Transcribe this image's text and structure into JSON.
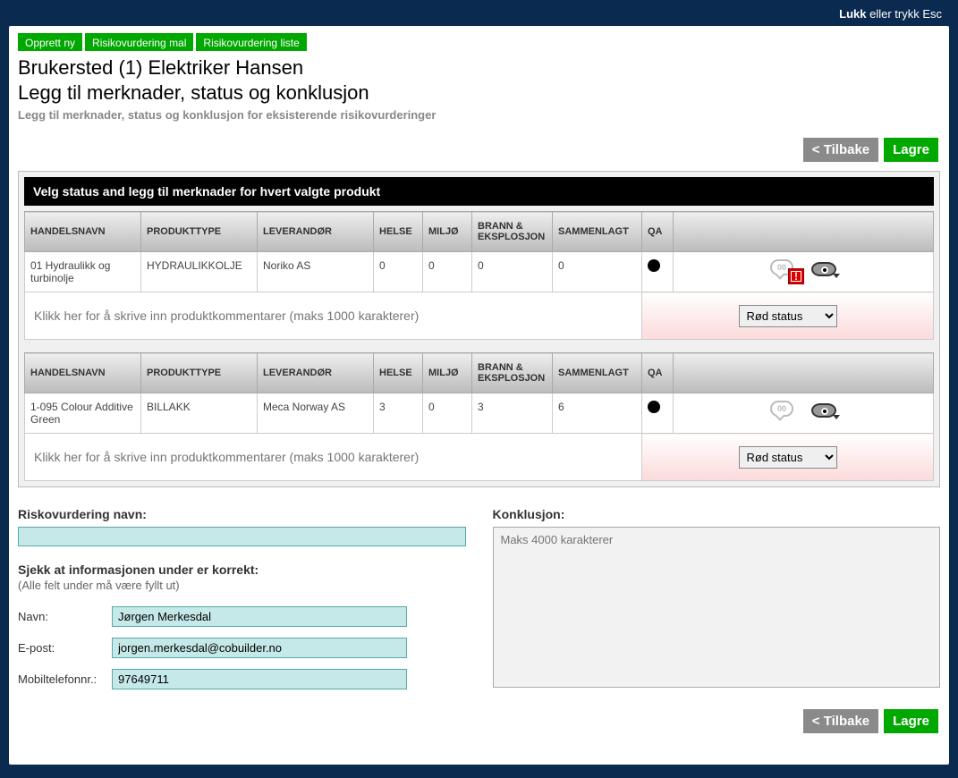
{
  "modal": {
    "close_text": "Lukk",
    "close_hint": " eller trykk Esc"
  },
  "tabs": {
    "a": "Opprett ny",
    "b": "Risikovurdering mal",
    "c": "Risikovurdering liste"
  },
  "title": "Brukersted (1) Elektriker Hansen",
  "subtitle": "Legg til merknader, status og konklusjon",
  "desc": "Legg til merknader, status og konklusjon for eksisterende risikovurderinger",
  "btn": {
    "back": "< Tilbake",
    "save": "Lagre"
  },
  "table_head": "Velg status and legg til merknader for hvert valgte produkt",
  "cols": {
    "handelsnavn": "HANDELSNAVN",
    "produkttype": "PRODUKTTYPE",
    "leverandor": "LEVERANDØR",
    "helse": "HELSE",
    "miljo": "MILJØ",
    "brann": "BRANN & EKSPLOSJON",
    "sammen": "SAMMENLAGT",
    "qa": "QA"
  },
  "rows": [
    {
      "navn": "01 Hydraulikk og turbinolje",
      "type": "HYDRAULIKKOLJE",
      "lev": "Noriko AS",
      "helse": "0",
      "miljo": "0",
      "brann": "0",
      "sammen": "0",
      "warn": "true"
    },
    {
      "navn": "1-095 Colour Additive Green",
      "type": "BILLAKK",
      "lev": "Meca Norway AS",
      "helse": "3",
      "miljo": "0",
      "brann": "3",
      "sammen": "6",
      "warn": "false"
    }
  ],
  "comment_ph": "Klikk her for å skrive inn produktkommentarer (maks 1000 karakterer)",
  "status_options": {
    "rod": "Rød status"
  },
  "bubble_text": "00",
  "left": {
    "risk_name_label": "Riskovurdering navn:",
    "check_head": "Sjekk at informasjonen under er korrekt:",
    "check_sub": "(Alle felt under må være fyllt ut)",
    "navn_label": "Navn:",
    "navn_val": "Jørgen Merkesdal",
    "epost_label": "E-post:",
    "epost_val": "jorgen.merkesdal@cobuilder.no",
    "mobil_label": "Mobiltelefonnr.:",
    "mobil_val": "97649711"
  },
  "right": {
    "konk_label": "Konklusjon:",
    "konk_ph": "Maks 4000 karakterer"
  }
}
